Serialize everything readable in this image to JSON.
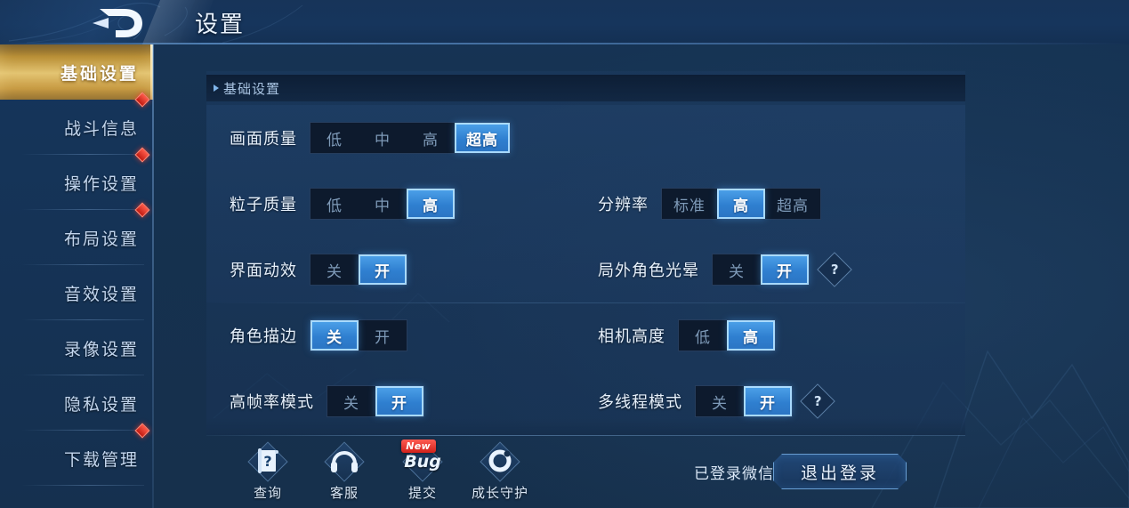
{
  "header": {
    "title": "设置",
    "logo_icon": "game-logo-icon"
  },
  "sidebar": {
    "items": [
      {
        "label": "基础设置",
        "active": true,
        "dot": false
      },
      {
        "label": "战斗信息",
        "active": false,
        "dot": true
      },
      {
        "label": "操作设置",
        "active": false,
        "dot": true
      },
      {
        "label": "布局设置",
        "active": false,
        "dot": true
      },
      {
        "label": "音效设置",
        "active": false,
        "dot": false
      },
      {
        "label": "录像设置",
        "active": false,
        "dot": false
      },
      {
        "label": "隐私设置",
        "active": false,
        "dot": false
      },
      {
        "label": "下载管理",
        "active": false,
        "dot": true
      }
    ]
  },
  "section": {
    "title": "基础设置"
  },
  "settings": {
    "rows": [
      {
        "band": 0,
        "left": {
          "label": "画面质量",
          "options": [
            "低",
            "中",
            "高",
            "超高"
          ],
          "selected": "超高",
          "help": false
        },
        "right": null
      },
      {
        "band": 0,
        "left": {
          "label": "粒子质量",
          "options": [
            "低",
            "中",
            "高"
          ],
          "selected": "高",
          "help": false
        },
        "right": {
          "label": "分辨率",
          "options": [
            "标准",
            "高",
            "超高"
          ],
          "selected": "高",
          "help": false
        }
      },
      {
        "band": 0,
        "left": {
          "label": "界面动效",
          "options": [
            "关",
            "开"
          ],
          "selected": "开",
          "help": false
        },
        "right": {
          "label": "局外角色光晕",
          "options": [
            "关",
            "开"
          ],
          "selected": "开",
          "help": true
        }
      },
      {
        "band": 1,
        "left": {
          "label": "角色描边",
          "options": [
            "关",
            "开"
          ],
          "selected": "关",
          "help": false
        },
        "right": {
          "label": "相机高度",
          "options": [
            "低",
            "高"
          ],
          "selected": "高",
          "help": false
        }
      },
      {
        "band": 1,
        "left": {
          "label": "高帧率模式",
          "options": [
            "关",
            "开"
          ],
          "selected": "开",
          "help": false
        },
        "right": {
          "label": "多线程模式",
          "options": [
            "关",
            "开"
          ],
          "selected": "开",
          "help": true
        }
      }
    ],
    "help_glyph": "?"
  },
  "bottombar": {
    "icons": [
      {
        "label": "查询",
        "icon": "query-scroll-icon",
        "badge": null,
        "glyph": "?"
      },
      {
        "label": "客服",
        "icon": "headset-icon",
        "badge": null,
        "glyph": ""
      },
      {
        "label": "提交",
        "icon": "bug-report-icon",
        "badge": "New",
        "glyph": "Bug"
      },
      {
        "label": "成长守护",
        "icon": "growth-guard-icon",
        "badge": null,
        "glyph": ""
      }
    ],
    "login_status": "已登录微信",
    "logout_label": "退出登录"
  },
  "colors": {
    "accent_blue": "#3f92de",
    "active_border": "#afdeff",
    "gold_active": "#e3c472",
    "badge_red": "#d0211a",
    "panel_bg": "#1c3a60"
  }
}
